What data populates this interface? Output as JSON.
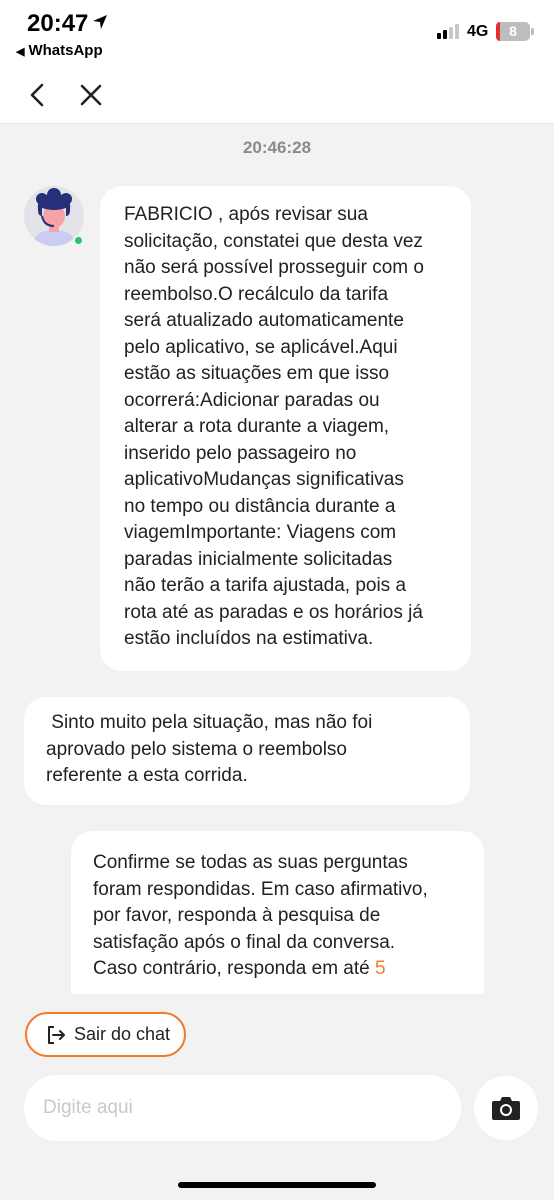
{
  "status_bar": {
    "time": "20:47",
    "back_app": "WhatsApp",
    "network": "4G",
    "battery_level": "8",
    "signal_bars": 2
  },
  "nav": {
    "back_icon": "chevron-left-icon",
    "close_icon": "close-icon"
  },
  "chat": {
    "timestamp": "20:46:28",
    "messages": [
      {
        "sender": "agent",
        "lines": [
          "FABRICIO , após revisar sua",
          "solicitação, constatei que desta vez",
          "não será possível prosseguir com o",
          "reembolso.O recálculo da tarifa",
          "será atualizado automaticamente",
          "pelo aplicativo, se aplicável.Aqui",
          "estão as situações em que isso",
          "ocorrerá:Adicionar paradas ou",
          "alterar a rota durante a viagem,",
          "inserido pelo passageiro no",
          "aplicativoMudanças significativas",
          "no tempo ou distância durante a",
          "viagemImportante: Viagens com",
          "paradas inicialmente solicitadas",
          "não terão a tarifa ajustada, pois a",
          "rota até as paradas e os horários já",
          "estão incluídos na estimativa."
        ]
      },
      {
        "sender": "agent",
        "lines": [
          " Sinto muito pela situação, mas não foi",
          "aprovado pelo sistema o reembolso",
          "referente a esta corrida."
        ]
      },
      {
        "sender": "system",
        "lines": [
          "Confirme se todas as suas perguntas",
          "foram respondidas. Em caso afirmativo,",
          "por favor, responda à pesquisa de",
          "satisfação após o final da conversa."
        ],
        "last_line_prefix": "Caso contrário, responda em até ",
        "last_line_highlight": "5"
      }
    ]
  },
  "exit_chat": {
    "label": "Sair do chat",
    "icon": "exit-icon"
  },
  "composer": {
    "placeholder": "Digite aqui",
    "camera_icon": "camera-icon"
  },
  "colors": {
    "accent": "#f07c2a",
    "online": "#27c46b",
    "battery_low": "#e03030",
    "background": "#f2f2f2"
  }
}
